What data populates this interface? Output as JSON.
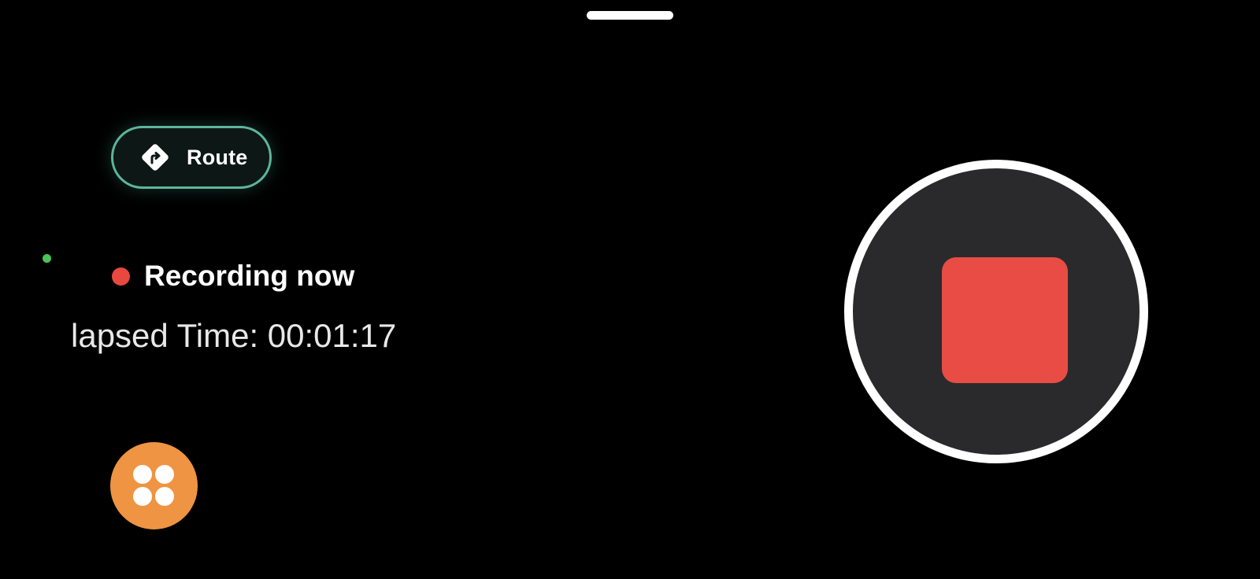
{
  "route_button": {
    "label": "Route",
    "icon": "turn-right-diamond-icon"
  },
  "recording": {
    "label": "Recording now",
    "indicator_color": "#e8483f"
  },
  "elapsed": {
    "text": "lapsed Time: 00:01:17"
  },
  "stop_button": {
    "icon": "stop-square-icon",
    "color": "#e84c45"
  },
  "menu_button": {
    "icon": "four-dots-menu-icon",
    "color": "#ef9442"
  },
  "colors": {
    "accent_teal": "#5fb59a",
    "status_green": "#4cc35a",
    "background": "#000000"
  }
}
